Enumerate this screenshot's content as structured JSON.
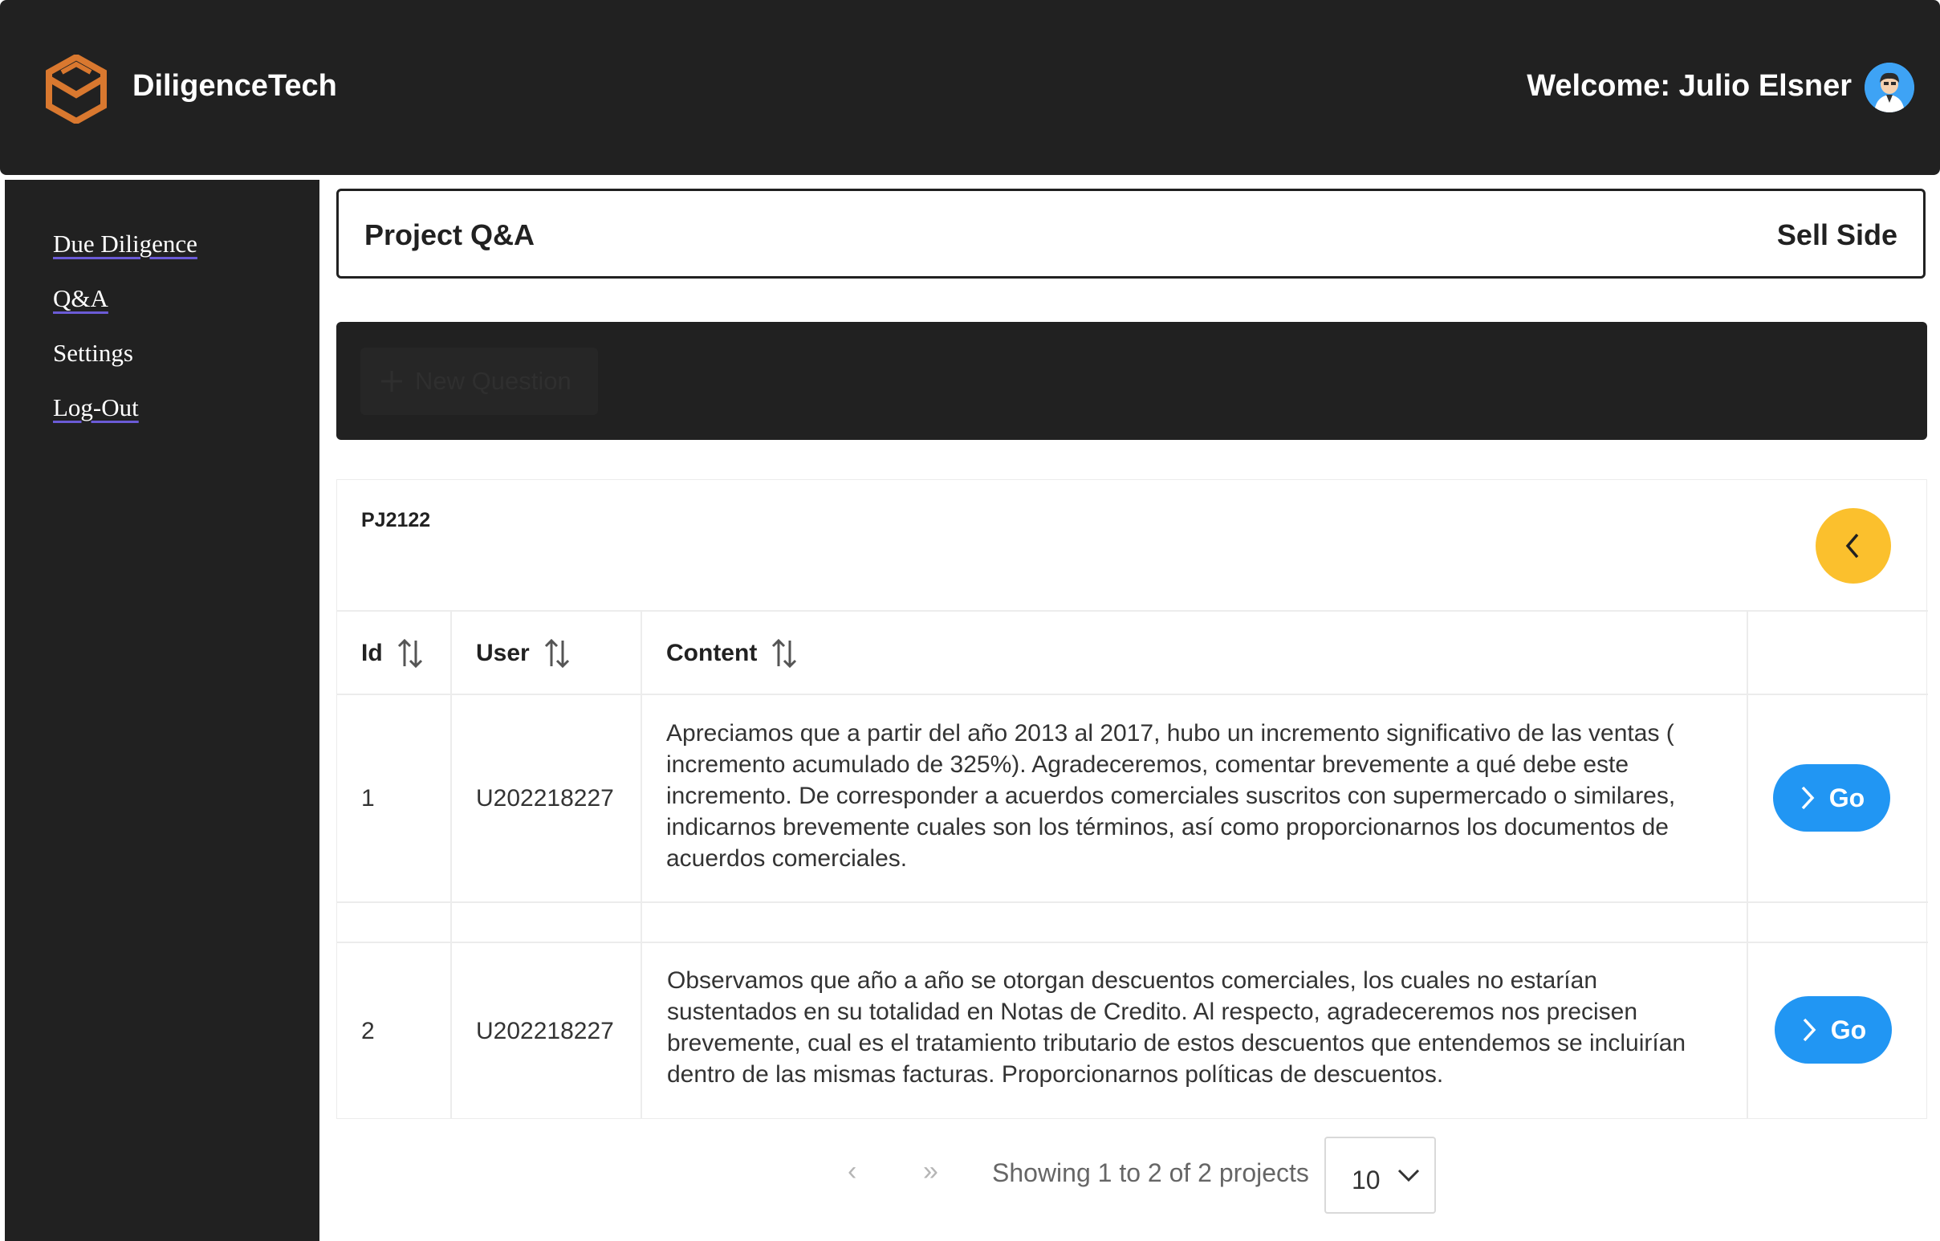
{
  "header": {
    "brand": "DiligenceTech",
    "welcome": "Welcome: Julio Elsner",
    "logo_color": "#d9782f",
    "avatar_color": "#3ea3f5"
  },
  "sidebar": {
    "items": [
      {
        "label": "Due Diligence"
      },
      {
        "label": "Q&A"
      },
      {
        "label": "Settings"
      },
      {
        "label": "Log-Out"
      }
    ]
  },
  "title_bar": {
    "title": "Project Q&A",
    "side": "Sell Side"
  },
  "toolbar": {
    "new_question_label": "New Question",
    "new_question_icon": "plus-icon"
  },
  "project": {
    "code": "PJ2122",
    "back_icon": "chevron-left-icon",
    "back_color": "#fbc02d"
  },
  "table": {
    "columns": [
      "Id",
      "User",
      "Content"
    ],
    "rows": [
      {
        "id": "1",
        "user": "U202218227",
        "content": "Apreciamos que a partir del año 2013 al 2017, hubo un incremento significativo de las ventas ( incremento acumulado de 325%). Agradeceremos, comentar brevemente a qué debe este incremento. De corresponder a acuerdos comerciales suscritos con supermercado o similares, indicarnos brevemente cuales son los términos, así como proporcionarnos los documentos de acuerdos comerciales.",
        "action": "Go"
      },
      {
        "id": "2",
        "user": "U202218227",
        "content": "Observamos que año a año se otorgan descuentos comerciales, los cuales no estarían sustentados en su totalidad en Notas de Credito. Al respecto, agradeceremos nos precisen brevemente, cual es el tratamiento tributario de estos descuentos que entendemos se incluirían dentro de las mismas facturas. Proporcionarnos políticas de descuentos.",
        "action": "Go"
      }
    ],
    "action_color": "#2196f3"
  },
  "pagination": {
    "prev": "‹",
    "last": "»",
    "showing": "Showing 1 to 2 of 2 projects",
    "per_page": "10"
  }
}
